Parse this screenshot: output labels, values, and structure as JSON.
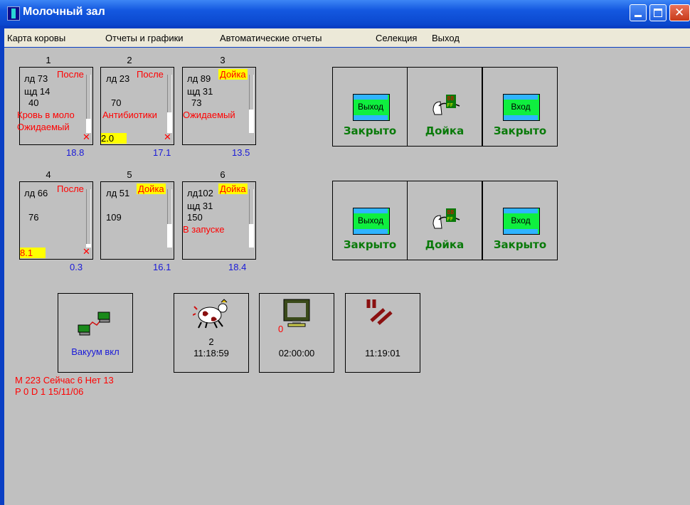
{
  "window": {
    "title": "Молочный зал"
  },
  "menu": [
    "Карта коровы",
    "Отчеты и графики",
    "Автоматические отчеты",
    "Селекция",
    "Выход"
  ],
  "stalls": [
    {
      "num": "1",
      "ld": "лд 73",
      "status": "После",
      "shd": "щд 14",
      "val": "40",
      "note1": "Кровь в моло",
      "note2": "Ожидаемый",
      "yield": "",
      "bottom": "18.8",
      "fill": 0.25
    },
    {
      "num": "2",
      "ld": "лд 23",
      "status": "После",
      "shd": "",
      "val": "70",
      "note1": "Антибиотики",
      "note2": "",
      "yield": "2.0",
      "bottom": "17.1",
      "fill": 0.35
    },
    {
      "num": "3",
      "ld": "лд 89",
      "status": "Дойка",
      "shd": "щд 31",
      "val": "73",
      "note1": "Ожидаемый",
      "note2": "",
      "yield": "",
      "bottom": "13.5",
      "fill": 0.4
    },
    {
      "num": "4",
      "ld": "лд 66",
      "status": "После",
      "shd": "",
      "val": "76",
      "note1": "",
      "note2": "",
      "yield": "8.1",
      "bottom": "0.3",
      "fill": 0.05
    },
    {
      "num": "5",
      "ld": "лд 51",
      "status": "Дойка",
      "shd": "",
      "val": "109",
      "note1": "",
      "note2": "",
      "yield": "",
      "bottom": "16.1",
      "fill": 0.4
    },
    {
      "num": "6",
      "ld": "лд102",
      "status": "Дойка",
      "shd": "щд 31",
      "val": "150",
      "note1": "В запуске",
      "note2": "",
      "yield": "",
      "bottom": "18.4",
      "fill": 0.4
    }
  ],
  "gate_rows": [
    [
      {
        "type": "gate",
        "label": "Выход",
        "status": "Закрыто"
      },
      {
        "type": "milk",
        "status": "Дойка",
        "display": "88",
        "ff": "FF"
      },
      {
        "type": "gate",
        "label": "Вход",
        "status": "Закрыто"
      }
    ],
    [
      {
        "type": "gate",
        "label": "Выход",
        "status": "Закрыто"
      },
      {
        "type": "milk",
        "status": "Дойка",
        "display": "88",
        "ff": "FF"
      },
      {
        "type": "gate",
        "label": "Вход",
        "status": "Закрыто"
      }
    ]
  ],
  "panels": {
    "vacuum": {
      "label": "Вакуум вкл"
    },
    "cow": {
      "count": "2",
      "time": "11:18:59"
    },
    "monitor": {
      "count": "0",
      "time": "02:00:00"
    },
    "wash": {
      "time": "11:19:01"
    }
  },
  "status_lines": [
    "M 223 Сейчас 6 Нет 13",
    "P 0 D 1 15/11/06"
  ],
  "colors": {
    "alert": "#ff0000",
    "yellow": "#ffff00",
    "gate_green": "#0fef3f",
    "status_green": "#0a7a0a",
    "blue": "#1a1ad8"
  }
}
